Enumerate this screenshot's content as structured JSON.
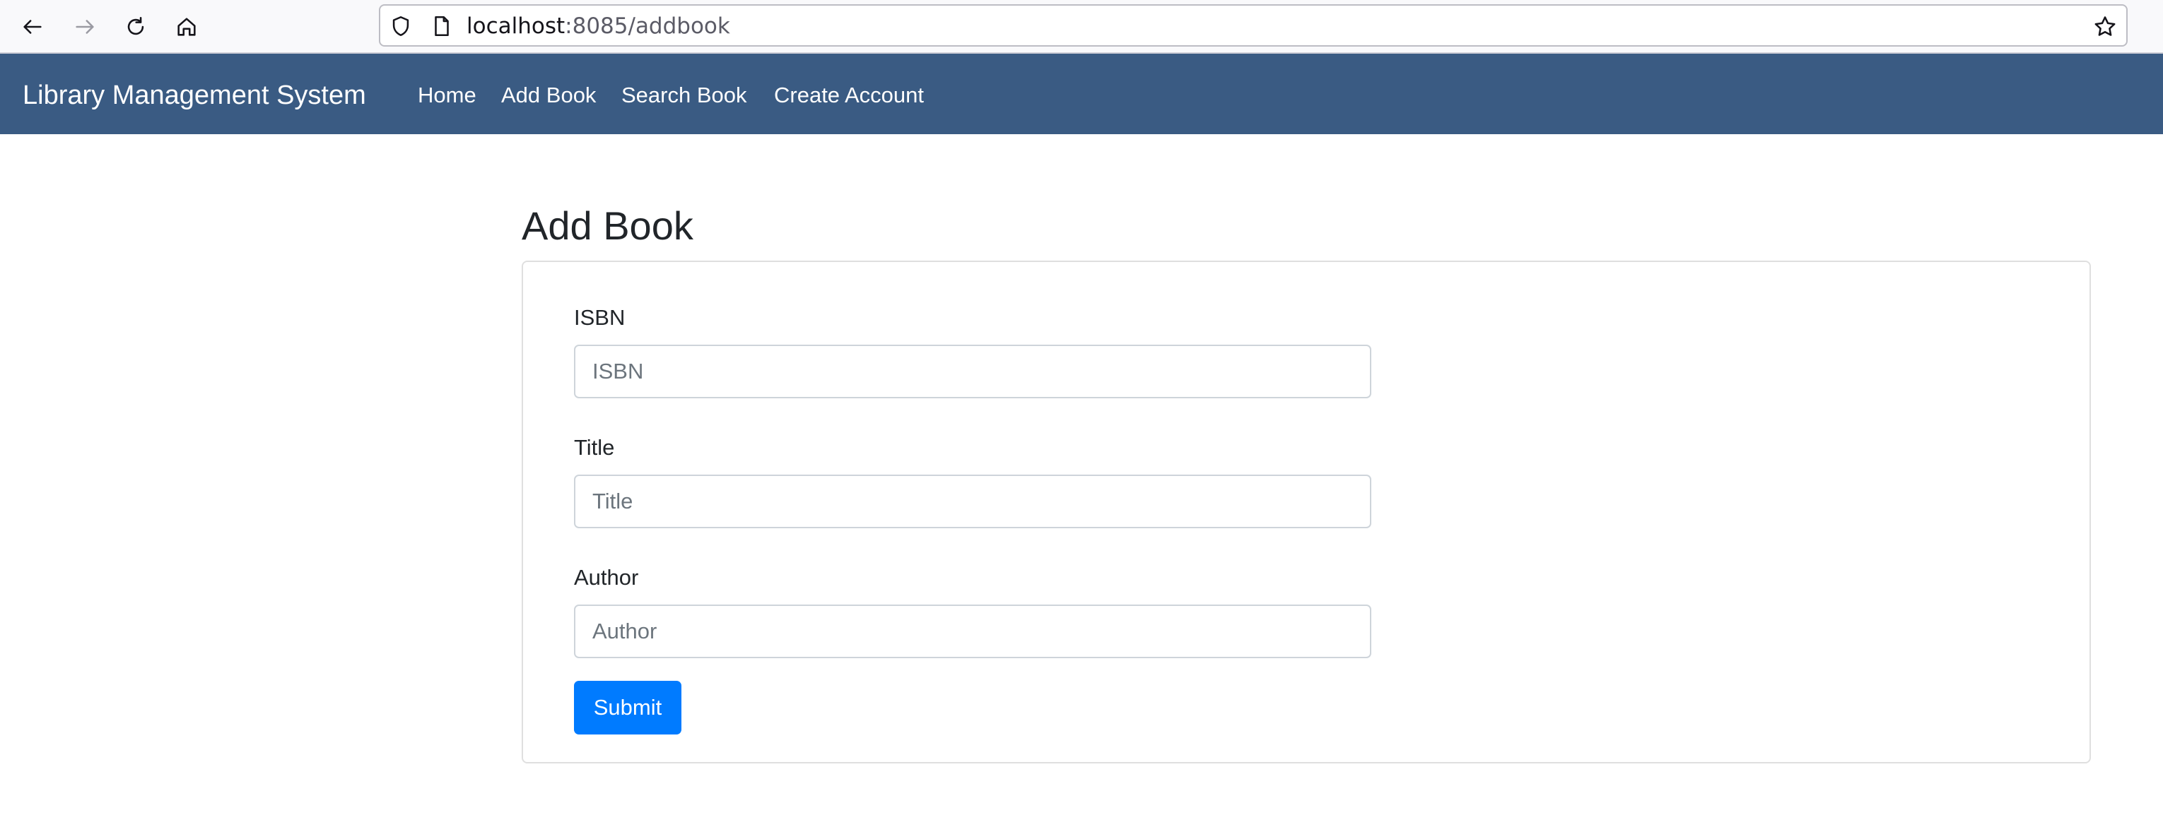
{
  "browser": {
    "url_host": "localhost",
    "url_path": ":8085/addbook",
    "icons": [
      "back-arrow-icon",
      "forward-arrow-icon",
      "reload-icon",
      "home-icon",
      "shield-icon",
      "page-icon",
      "star-icon"
    ]
  },
  "navbar": {
    "brand": "Library Management System",
    "background": "#3a5b83",
    "links": [
      "Home",
      "Add Book",
      "Search Book",
      "Create Account"
    ]
  },
  "main": {
    "title": "Add Book",
    "form": {
      "isbn": {
        "label": "ISBN",
        "placeholder": "ISBN",
        "value": ""
      },
      "title": {
        "label": "Title",
        "placeholder": "Title",
        "value": ""
      },
      "author": {
        "label": "Author",
        "placeholder": "Author",
        "value": ""
      },
      "submit_label": "Submit",
      "submit_color": "#007bff"
    }
  }
}
